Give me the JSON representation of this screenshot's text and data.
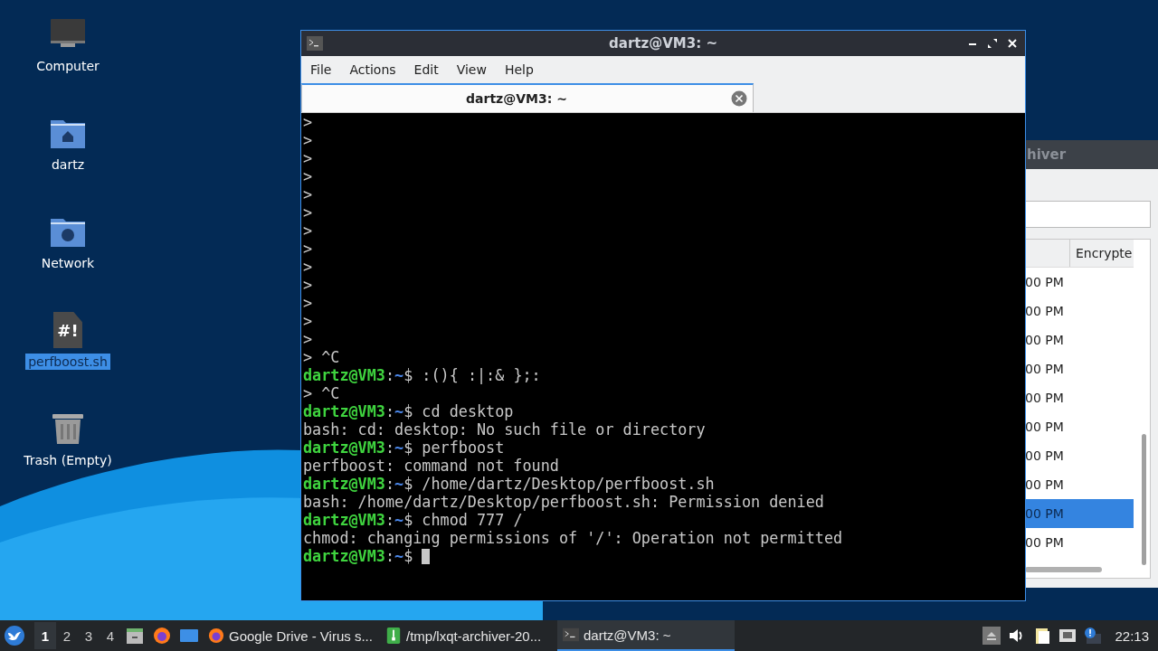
{
  "desktop": {
    "icons": [
      {
        "kind": "computer",
        "label": "Computer",
        "selected": false
      },
      {
        "kind": "home-folder",
        "label": "dartz",
        "selected": false
      },
      {
        "kind": "network-folder",
        "label": "Network",
        "selected": false
      },
      {
        "kind": "script",
        "label": "perfboost.sh",
        "glyph": "#!",
        "selected": true
      },
      {
        "kind": "trash",
        "label": "Trash (Empty)",
        "selected": false
      }
    ]
  },
  "archiver_window": {
    "title": "hiver",
    "column_header": "Encrypte",
    "rows": [
      {
        "text": "00 PM",
        "selected": false
      },
      {
        "text": "00 PM",
        "selected": false
      },
      {
        "text": "00 PM",
        "selected": false
      },
      {
        "text": "00 PM",
        "selected": false
      },
      {
        "text": "00 PM",
        "selected": false
      },
      {
        "text": "00 PM",
        "selected": false
      },
      {
        "text": "00 PM",
        "selected": false
      },
      {
        "text": "00 PM",
        "selected": false
      },
      {
        "text": "00 PM",
        "selected": true
      },
      {
        "text": "00 PM",
        "selected": false
      }
    ]
  },
  "terminal_window": {
    "title": "dartz@VM3: ~",
    "menu": [
      "File",
      "Actions",
      "Edit",
      "View",
      "Help"
    ],
    "tab": {
      "label": "dartz@VM3: ~",
      "selected": true
    },
    "cursor_visible": true,
    "lines": [
      {
        "kind": "output",
        "text": ">"
      },
      {
        "kind": "output",
        "text": ">"
      },
      {
        "kind": "output",
        "text": ">"
      },
      {
        "kind": "output",
        "text": ">"
      },
      {
        "kind": "output",
        "text": ">"
      },
      {
        "kind": "output",
        "text": ">"
      },
      {
        "kind": "output",
        "text": ">"
      },
      {
        "kind": "output",
        "text": ">"
      },
      {
        "kind": "output",
        "text": ">"
      },
      {
        "kind": "output",
        "text": ">"
      },
      {
        "kind": "output",
        "text": ">"
      },
      {
        "kind": "output",
        "text": ">"
      },
      {
        "kind": "output",
        "text": ">"
      },
      {
        "kind": "output",
        "text": "> ^C"
      },
      {
        "kind": "prompt",
        "user": "dartz@VM3",
        "sep": ":",
        "path": "~",
        "command": "$ :(){ :|:& };:"
      },
      {
        "kind": "output",
        "text": "> ^C"
      },
      {
        "kind": "prompt",
        "user": "dartz@VM3",
        "sep": ":",
        "path": "~",
        "command": "$ cd desktop"
      },
      {
        "kind": "output",
        "text": "bash: cd: desktop: No such file or directory"
      },
      {
        "kind": "prompt",
        "user": "dartz@VM3",
        "sep": ":",
        "path": "~",
        "command": "$ perfboost"
      },
      {
        "kind": "output",
        "text": "perfboost: command not found"
      },
      {
        "kind": "prompt",
        "user": "dartz@VM3",
        "sep": ":",
        "path": "~",
        "command": "$ /home/dartz/Desktop/perfboost.sh"
      },
      {
        "kind": "output",
        "text": "bash: /home/dartz/Desktop/perfboost.sh: Permission denied"
      },
      {
        "kind": "prompt",
        "user": "dartz@VM3",
        "sep": ":",
        "path": "~",
        "command": "$ chmod 777 /"
      },
      {
        "kind": "output",
        "text": "chmod: changing permissions of '/': Operation not permitted"
      },
      {
        "kind": "prompt",
        "user": "dartz@VM3",
        "sep": ":",
        "path": "~",
        "command": "$ "
      }
    ]
  },
  "taskbar": {
    "workspaces": [
      {
        "label": "1",
        "selected": true
      },
      {
        "label": "2",
        "selected": false
      },
      {
        "label": "3",
        "selected": false
      },
      {
        "label": "4",
        "selected": false
      }
    ],
    "launchers": [
      {
        "kind": "files"
      },
      {
        "kind": "browser"
      },
      {
        "kind": "desktop"
      }
    ],
    "tasks": [
      {
        "kind": "browser",
        "label": "Google Drive - Virus s...",
        "selected": false
      },
      {
        "kind": "archive",
        "label": "/tmp/lxqt-archiver-20...",
        "selected": false
      },
      {
        "kind": "terminal",
        "label": "dartz@VM3: ~",
        "selected": true
      }
    ],
    "clock": "22:13"
  }
}
